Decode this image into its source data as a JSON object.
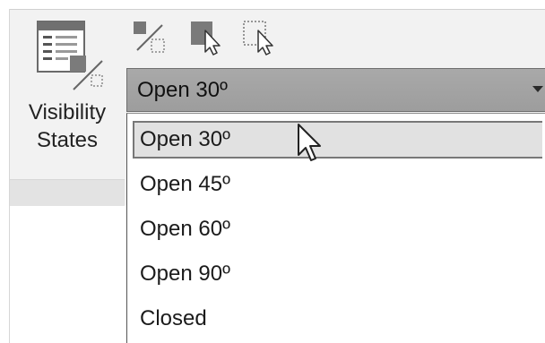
{
  "ribbon": {
    "visibility_states_button": {
      "label": "Visibility\nStates",
      "icon": "visibility-states-icon"
    },
    "tools": [
      {
        "icon": "override-visibility-icon"
      },
      {
        "icon": "select-visible-icon"
      },
      {
        "icon": "select-hidden-icon"
      }
    ]
  },
  "combo": {
    "selected_value": "Open 30º"
  },
  "dropdown": {
    "items": [
      {
        "label": "Open 30º",
        "selected": true
      },
      {
        "label": "Open 45º",
        "selected": false
      },
      {
        "label": "Open 60º",
        "selected": false
      },
      {
        "label": "Open 90º",
        "selected": false
      },
      {
        "label": "Closed",
        "selected": false
      }
    ]
  },
  "colors": {
    "ribbon_bg": "#f2f2f2",
    "combo_bg": "#a3a3a3",
    "selected_item_bg": "#e1e1e1"
  }
}
